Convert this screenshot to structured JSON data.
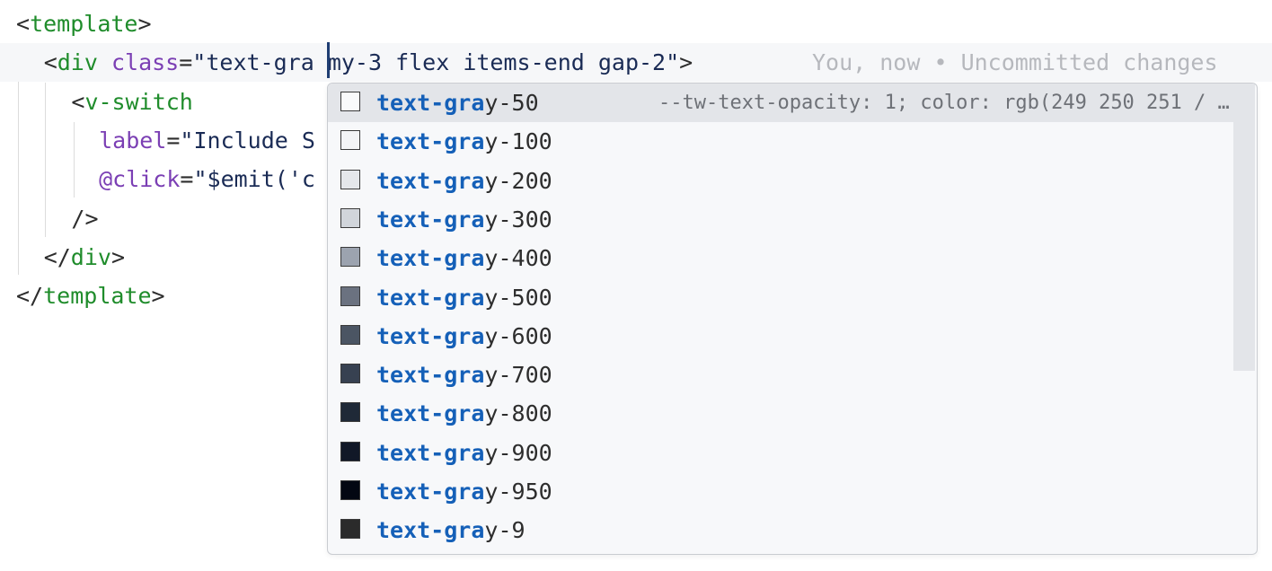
{
  "editor": {
    "lines": [
      {
        "indent": "",
        "parts": [
          [
            "punct",
            "<"
          ],
          [
            "tag",
            "template"
          ],
          [
            "punct",
            ">"
          ]
        ]
      },
      {
        "indent": "  ",
        "parts": [
          [
            "punct",
            "<"
          ],
          [
            "tag",
            "div"
          ],
          [
            "punct",
            " "
          ],
          [
            "attr",
            "class"
          ],
          [
            "punct",
            "="
          ],
          [
            "str",
            "\"text-gra"
          ],
          [
            "str",
            " my-3 flex items-end gap-2\""
          ],
          [
            "punct",
            ">"
          ]
        ]
      },
      {
        "indent": "    ",
        "parts": [
          [
            "punct",
            "<"
          ],
          [
            "tag",
            "v-switch"
          ]
        ]
      },
      {
        "indent": "      ",
        "parts": [
          [
            "attr",
            "label"
          ],
          [
            "punct",
            "="
          ],
          [
            "str",
            "\"Include S"
          ]
        ]
      },
      {
        "indent": "      ",
        "parts": [
          [
            "attr",
            "@click"
          ],
          [
            "punct",
            "="
          ],
          [
            "str",
            "\"$emit('c"
          ]
        ]
      },
      {
        "indent": "    ",
        "parts": [
          [
            "punct",
            "/>"
          ]
        ]
      },
      {
        "indent": "  ",
        "parts": [
          [
            "punct",
            "</"
          ],
          [
            "tag",
            "div"
          ],
          [
            "punct",
            ">"
          ]
        ]
      },
      {
        "indent": "",
        "parts": [
          [
            "punct",
            "</"
          ],
          [
            "tag",
            "template"
          ],
          [
            "punct",
            ">"
          ]
        ]
      }
    ],
    "blame": "You, now • Uncommitted changes"
  },
  "completion": {
    "match": "text-gra",
    "selected_detail": "--tw-text-opacity: 1; color: rgb(249 250 251 / …",
    "items": [
      {
        "rest": "y-50",
        "color": "#f9fafb"
      },
      {
        "rest": "y-100",
        "color": "#f3f4f6"
      },
      {
        "rest": "y-200",
        "color": "#e5e7eb"
      },
      {
        "rest": "y-300",
        "color": "#d1d5db"
      },
      {
        "rest": "y-400",
        "color": "#9ca3af"
      },
      {
        "rest": "y-500",
        "color": "#6b7280"
      },
      {
        "rest": "y-600",
        "color": "#4b5563"
      },
      {
        "rest": "y-700",
        "color": "#374151"
      },
      {
        "rest": "y-800",
        "color": "#1f2937"
      },
      {
        "rest": "y-900",
        "color": "#111827"
      },
      {
        "rest": "y-950",
        "color": "#030712"
      },
      {
        "rest": "y-9",
        "color": "#2b2b2b"
      }
    ]
  }
}
